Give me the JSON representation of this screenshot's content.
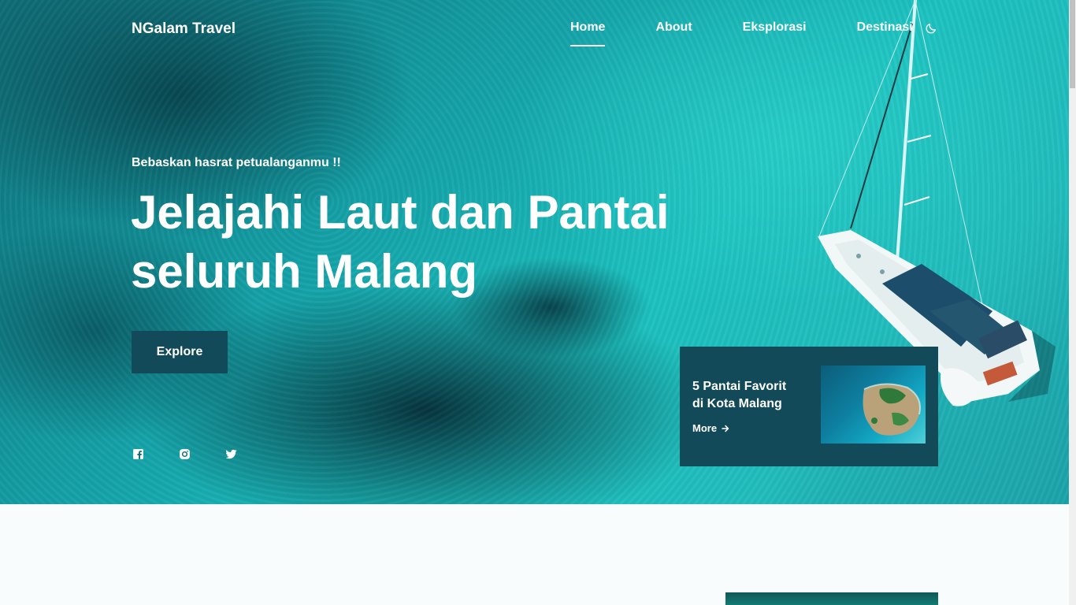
{
  "brand": "NGalam Travel",
  "nav": {
    "items": [
      {
        "label": "Home",
        "active": true
      },
      {
        "label": "About",
        "active": false
      },
      {
        "label": "Eksplorasi",
        "active": false
      },
      {
        "label": "Destinasi",
        "active": false
      }
    ],
    "theme_icon": "moon-icon"
  },
  "hero": {
    "subtitle": "Bebaskan hasrat petualanganmu !!",
    "headline_line1": "Jelajahi Laut dan Pantai",
    "headline_line2": "seluruh Malang",
    "cta_label": "Explore",
    "social_icons": [
      "facebook-icon",
      "instagram-icon",
      "twitter-icon"
    ]
  },
  "card": {
    "title_line1": "5 Pantai Favorit",
    "title_line2": "di Kota Malang",
    "more_label": "More",
    "more_icon": "arrow-right-icon"
  },
  "colors": {
    "accent": "#134a5a",
    "text": "#ffffff",
    "page_bg": "#f8fcfd"
  }
}
